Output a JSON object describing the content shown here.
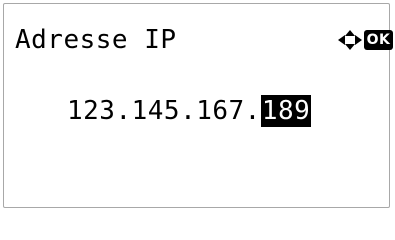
{
  "screen": {
    "title": "Adresse IP",
    "nav_icon": "four-way-arrow-icon",
    "ok_label": "OK"
  },
  "ip_address": {
    "prefix": "123.145.167.",
    "selected_octet": "189"
  }
}
